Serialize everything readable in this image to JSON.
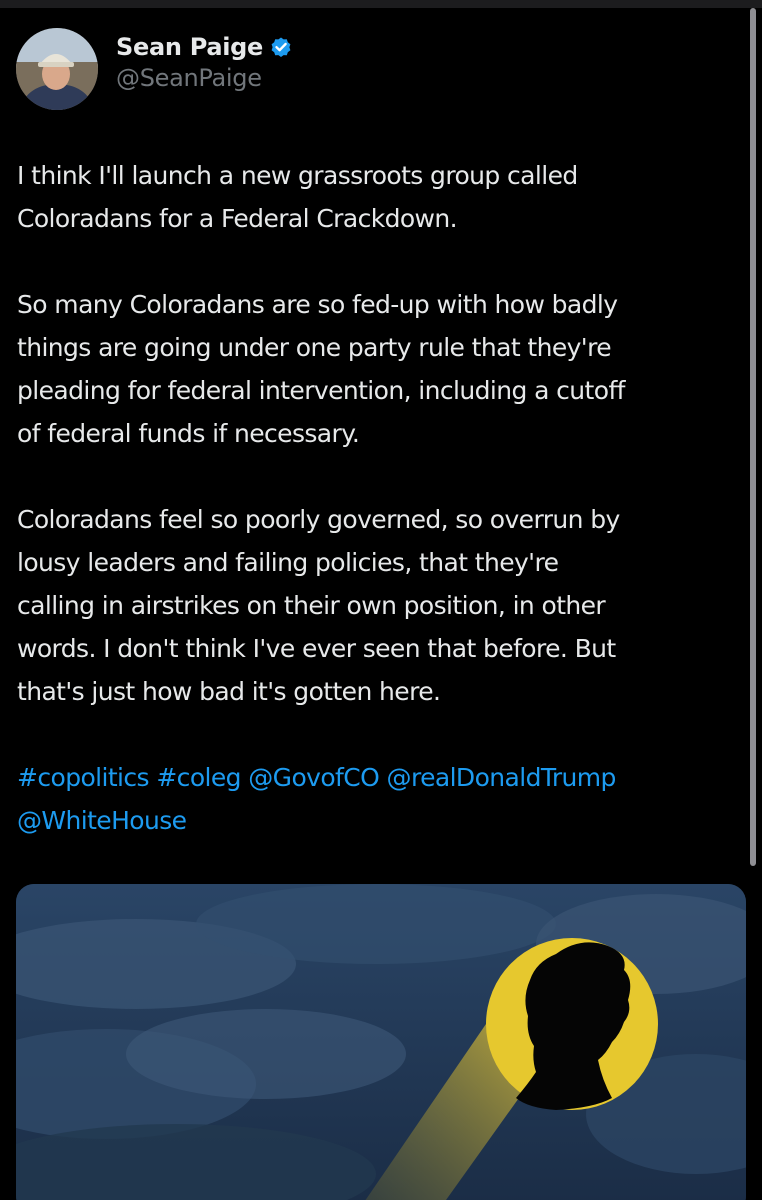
{
  "author": {
    "name": "Sean Paige",
    "handle": "@SeanPaige",
    "verified_icon": "verified-badge-icon",
    "verified_color": "#1d9bf0"
  },
  "tweet": {
    "paragraph1": [
      "I think I'll launch a new grassroots group called",
      "Coloradans for a Federal Crackdown."
    ],
    "paragraph2": [
      "So many Coloradans are so fed-up with how badly",
      "things are going under one party rule that they're",
      "pleading for federal intervention, including a cutoff",
      "of federal funds if necessary."
    ],
    "paragraph3": [
      "Coloradans feel so poorly governed, so overrun by",
      "lousy leaders and failing policies, that they're",
      "calling in airstrikes on their own position, in other",
      "words. I don't think I've ever seen that before. But",
      "that's just how bad it's gotten here."
    ],
    "tags": {
      "hashtag1": "#copolitics",
      "hashtag2": "#coleg",
      "mention1": "@GovofCO",
      "mention2": "@realDonaldTrump",
      "mention3": "@WhiteHouse"
    }
  },
  "colors": {
    "background": "#000000",
    "text": "#e7e9ea",
    "secondary_text": "#71767b",
    "link": "#1d9bf0",
    "signal_yellow": "#e6c82e"
  }
}
